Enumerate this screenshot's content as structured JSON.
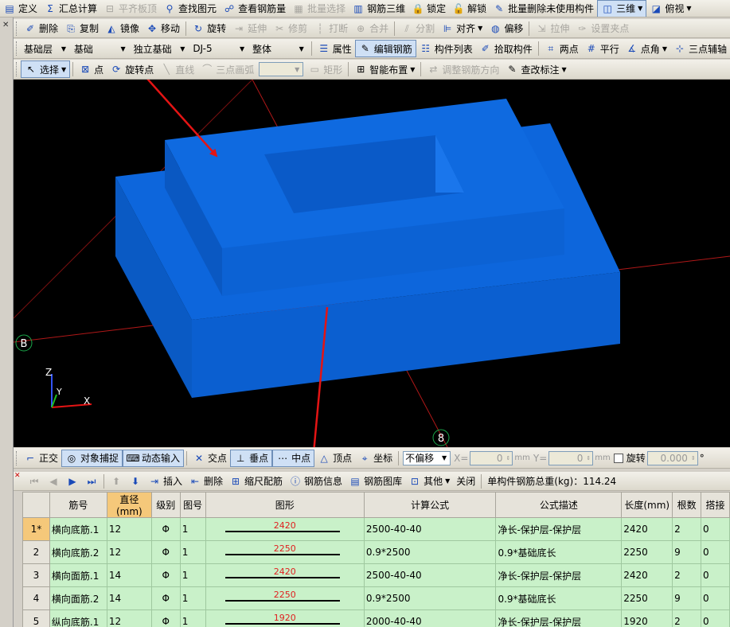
{
  "menubar": {
    "items": [
      {
        "icon": "definition-icon",
        "label": "定义",
        "enabled": true
      },
      {
        "icon": "sigma-icon",
        "label": "汇总计算",
        "enabled": true
      },
      {
        "icon": "level-slab-icon",
        "label": "平齐板顶",
        "enabled": false
      },
      {
        "icon": "find-element-icon",
        "label": "查找图元",
        "enabled": true
      },
      {
        "icon": "view-rebar-icon",
        "label": "查看钢筋量",
        "enabled": true
      },
      {
        "icon": "batch-select-icon",
        "label": "批量选择",
        "enabled": false
      },
      {
        "icon": "rebar-3d-icon",
        "label": "钢筋三维",
        "enabled": true
      },
      {
        "icon": "lock-icon",
        "label": "锁定",
        "enabled": true
      },
      {
        "icon": "unlock-icon",
        "label": "解锁",
        "enabled": true
      },
      {
        "icon": "batch-delete-icon",
        "label": "批量删除未使用构件",
        "enabled": true
      }
    ],
    "view_mode": "三维",
    "view_dir": "俯视"
  },
  "toolbar_edit": {
    "items": [
      {
        "icon": "delete-icon",
        "label": "删除",
        "enabled": true
      },
      {
        "icon": "copy-icon",
        "label": "复制",
        "enabled": true
      },
      {
        "icon": "mirror-icon",
        "label": "镜像",
        "enabled": true
      },
      {
        "icon": "move-icon",
        "label": "移动",
        "enabled": true
      },
      {
        "icon": "rotate-icon",
        "label": "旋转",
        "enabled": true
      },
      {
        "icon": "extend-icon",
        "label": "延伸",
        "enabled": false
      },
      {
        "icon": "trim-icon",
        "label": "修剪",
        "enabled": false
      },
      {
        "icon": "break-icon",
        "label": "打断",
        "enabled": false
      },
      {
        "icon": "merge-icon",
        "label": "合并",
        "enabled": false
      },
      {
        "icon": "split-icon",
        "label": "分割",
        "enabled": false
      },
      {
        "icon": "align-icon",
        "label": "对齐",
        "enabled": true
      },
      {
        "icon": "offset-icon",
        "label": "偏移",
        "enabled": true
      },
      {
        "icon": "stretch-icon",
        "label": "拉伸",
        "enabled": false
      },
      {
        "icon": "set-grip-icon",
        "label": "设置夹点",
        "enabled": false
      }
    ]
  },
  "toolbar_prop": {
    "layer": "基础层",
    "category": "基础",
    "type": "独立基础",
    "component": "DJ-5",
    "scope": "整体",
    "buttons": [
      {
        "icon": "property-icon",
        "label": "属性",
        "active": false
      },
      {
        "icon": "edit-rebar-icon",
        "label": "编辑钢筋",
        "active": true
      },
      {
        "icon": "component-list-icon",
        "label": "构件列表",
        "active": false
      },
      {
        "icon": "pick-component-icon",
        "label": "拾取构件",
        "active": false
      },
      {
        "icon": "two-point-icon",
        "label": "两点",
        "active": false
      },
      {
        "icon": "parallel-icon",
        "label": "平行",
        "active": false
      },
      {
        "icon": "point-angle-icon",
        "label": "点角",
        "active": false
      },
      {
        "icon": "three-point-aux-icon",
        "label": "三点辅轴",
        "active": false
      }
    ]
  },
  "toolbar_draw": {
    "select": "选择",
    "items": [
      {
        "icon": "point-icon",
        "label": "点",
        "enabled": true
      },
      {
        "icon": "rotate-point-icon",
        "label": "旋转点",
        "enabled": true
      },
      {
        "icon": "line-icon",
        "label": "直线",
        "enabled": false
      },
      {
        "icon": "arc-icon",
        "label": "三点画弧",
        "enabled": false
      }
    ],
    "rect": "矩形",
    "smart_layout": "智能布置",
    "adjust_dir": "调整钢筋方向",
    "check_mark": "查改标注"
  },
  "viewport": {
    "axis_b": "B",
    "axis_8": "8",
    "axis_z": "Z",
    "axis_y": "Y",
    "axis_x": "X"
  },
  "status": {
    "items": [
      {
        "icon": "ortho-icon",
        "label": "正交",
        "active": false
      },
      {
        "icon": "snap-icon",
        "label": "对象捕捉",
        "active": true
      },
      {
        "icon": "dynamic-input-icon",
        "label": "动态输入",
        "active": true
      },
      {
        "icon": "intersection-icon",
        "label": "交点",
        "active": false
      },
      {
        "icon": "perpendicular-icon",
        "label": "垂点",
        "active": true
      },
      {
        "icon": "midpoint-icon",
        "label": "中点",
        "active": true
      },
      {
        "icon": "vertex-icon",
        "label": "顶点",
        "active": false
      },
      {
        "icon": "coordinate-icon",
        "label": "坐标",
        "active": false
      }
    ],
    "offset_mode": "不偏移",
    "x_label": "X=",
    "x_value": "0",
    "y_label": "Y=",
    "y_value": "0",
    "unit": "mm",
    "rotate_label": "旋转",
    "rotate_value": "0.000",
    "degree": "°"
  },
  "grid_toolbar": {
    "items": [
      {
        "icon": "insert-icon",
        "label": "插入"
      },
      {
        "icon": "delete-row-icon",
        "label": "删除"
      },
      {
        "icon": "scale-rebar-icon",
        "label": "缩尺配筋"
      },
      {
        "icon": "rebar-info-icon",
        "label": "钢筋信息"
      },
      {
        "icon": "rebar-library-icon",
        "label": "钢筋图库"
      },
      {
        "icon": "other-icon",
        "label": "其他"
      }
    ],
    "close": "关闭",
    "total_weight": "单构件钢筋总重(kg)：114.24"
  },
  "table": {
    "headers": [
      "",
      "筋号",
      "直径(mm)",
      "级别",
      "图号",
      "图形",
      "计算公式",
      "公式描述",
      "长度(mm)",
      "根数",
      "搭接"
    ],
    "rows": [
      {
        "n": "1*",
        "name": "横向底筋.1",
        "dia": "12",
        "grade": "Φ",
        "fig": "1",
        "shape": "2420",
        "formula": "2500-40-40",
        "desc": "净长-保护层-保护层",
        "len": "2420",
        "count": "2",
        "lap": "0"
      },
      {
        "n": "2",
        "name": "横向底筋.2",
        "dia": "12",
        "grade": "Φ",
        "fig": "1",
        "shape": "2250",
        "formula": "0.9*2500",
        "desc": "0.9*基础底长",
        "len": "2250",
        "count": "9",
        "lap": "0"
      },
      {
        "n": "3",
        "name": "横向面筋.1",
        "dia": "14",
        "grade": "Φ",
        "fig": "1",
        "shape": "2420",
        "formula": "2500-40-40",
        "desc": "净长-保护层-保护层",
        "len": "2420",
        "count": "2",
        "lap": "0"
      },
      {
        "n": "4",
        "name": "横向面筋.2",
        "dia": "14",
        "grade": "Φ",
        "fig": "1",
        "shape": "2250",
        "formula": "0.9*2500",
        "desc": "0.9*基础底长",
        "len": "2250",
        "count": "9",
        "lap": "0"
      },
      {
        "n": "5",
        "name": "纵向底筋.1",
        "dia": "12",
        "grade": "Φ",
        "fig": "1",
        "shape": "1920",
        "formula": "2000-40-40",
        "desc": "净长-保护层-保护层",
        "len": "1920",
        "count": "2",
        "lap": "0"
      }
    ]
  },
  "colors": {
    "model_blue": "#0a62d6",
    "arrow_red": "#e41414",
    "grid_green": "#c9f1c9"
  }
}
